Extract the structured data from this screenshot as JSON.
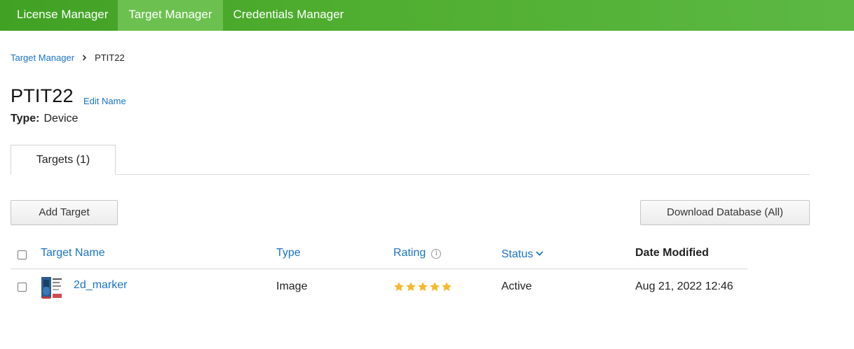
{
  "nav": {
    "items": [
      {
        "label": "License Manager",
        "active": false
      },
      {
        "label": "Target Manager",
        "active": true
      },
      {
        "label": "Credentials Manager",
        "active": false
      }
    ]
  },
  "breadcrumb": {
    "parent": "Target Manager",
    "separator": ">",
    "current": "PTIT22"
  },
  "database": {
    "name": "PTIT22",
    "edit_label": "Edit Name",
    "type_label": "Type:",
    "type_value": "Device"
  },
  "tabs": [
    {
      "label": "Targets (1)",
      "active": true
    }
  ],
  "toolbar": {
    "add_label": "Add Target",
    "download_label": "Download Database (All)"
  },
  "table": {
    "columns": {
      "name": "Target Name",
      "type": "Type",
      "rating": "Rating",
      "status": "Status",
      "date": "Date Modified"
    },
    "rows": [
      {
        "name": "2d_marker",
        "type": "Image",
        "rating": 5,
        "status": "Active",
        "date": "Aug 21, 2022 12:46"
      }
    ]
  },
  "colors": {
    "nav_green": "#4fad2f",
    "link_blue": "#1a73c8",
    "star_gold": "#f5b82e"
  }
}
